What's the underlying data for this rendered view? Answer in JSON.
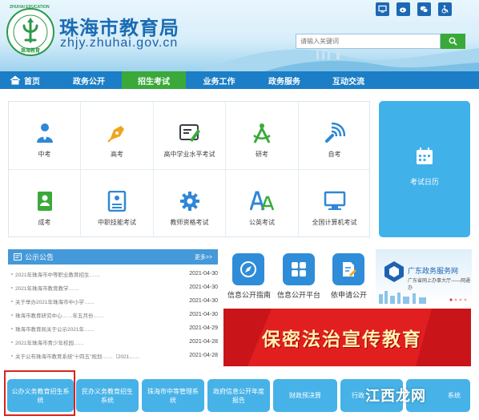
{
  "header": {
    "title": "珠海市教育局",
    "domain": "zhjy.zhuhai.gov.cn",
    "logo_text": "ZHUHAI EDUCATION",
    "logo_cn": "珠海教育",
    "top_icons": [
      "computer-icon",
      "weibo-icon",
      "wechat-icon",
      "accessibility-icon"
    ]
  },
  "search": {
    "placeholder": "请输入关键词"
  },
  "nav": {
    "items": [
      {
        "label": "首页"
      },
      {
        "label": "政务公开"
      },
      {
        "label": "招生考试"
      },
      {
        "label": "业务工作"
      },
      {
        "label": "政务服务"
      },
      {
        "label": "互动交流"
      }
    ],
    "active_index": 2
  },
  "exams": [
    {
      "label": "中考",
      "icon": "person-icon"
    },
    {
      "label": "高考",
      "icon": "pen-nib-icon"
    },
    {
      "label": "高中学业水平考试",
      "icon": "certificate-icon"
    },
    {
      "label": "研考",
      "icon": "compass-icon"
    },
    {
      "label": "自考",
      "icon": "broadcast-icon"
    },
    {
      "label": "成考",
      "icon": "contacts-book-icon"
    },
    {
      "label": "中职技能考试",
      "icon": "id-card-icon"
    },
    {
      "label": "教师资格考试",
      "icon": "gear-icon"
    },
    {
      "label": "公英考试",
      "icon": "letters-aa-icon"
    },
    {
      "label": "全国计算机考试",
      "icon": "monitor-icon"
    }
  ],
  "calendar": {
    "label": "考试日历"
  },
  "notice": {
    "title": "公示公告",
    "more": "更多>>",
    "items": [
      {
        "title": "2021年珠海市中等职业教育招生……",
        "date": "2021-04-30"
      },
      {
        "title": "2021年珠海市教育教学……",
        "date": "2021-04-30"
      },
      {
        "title": "关于举办2021年珠海市中小学……",
        "date": "2021-04-30"
      },
      {
        "title": "珠海市教育研究中心……年五月份……",
        "date": "2021-04-30"
      },
      {
        "title": "珠海市教育局关于公示2021年……",
        "date": "2021-04-29"
      },
      {
        "title": "2021年珠海市青少年校园……",
        "date": "2021-04-28"
      },
      {
        "title": "关于公布珠海市教育系统“十四五”规划……（2021……",
        "date": "2021-04-28"
      }
    ]
  },
  "services": [
    {
      "label": "信息公开指南",
      "icon": "compass-icon"
    },
    {
      "label": "信息公开平台",
      "icon": "grid-icon"
    },
    {
      "label": "依申请公开",
      "icon": "document-edit-icon"
    }
  ],
  "gd_banner": {
    "title": "广东政务服务网",
    "subtitle": "广东省网上办事大厅——网通办"
  },
  "law_banner": {
    "text": "保密法治宣传教育"
  },
  "bottom_buttons": [
    {
      "label": "公办义务教育招生系统"
    },
    {
      "label": "民办义务教育招生系统"
    },
    {
      "label": "珠海市中等管理系统"
    },
    {
      "label": "政府信息公开年度报告"
    },
    {
      "label": "财政预决算"
    },
    {
      "label": "行政"
    },
    {
      "label": "系统"
    }
  ],
  "watermark": {
    "text": "江西龙网"
  },
  "colors": {
    "nav_blue": "#1b7ec6",
    "nav_active_green": "#3aa93a",
    "tile_blue": "#46b2e8",
    "highlight_red": "#d9231f"
  }
}
